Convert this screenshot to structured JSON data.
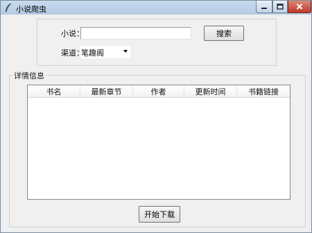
{
  "window": {
    "title": "小说爬虫",
    "icon": "feather-icon"
  },
  "search": {
    "novel_label": "小说：",
    "novel_value": "",
    "search_button": "搜索",
    "channel_label": "渠道：",
    "channel_selected": "笔趣阁"
  },
  "details": {
    "group_label": "详情信息",
    "columns": [
      "书名",
      "最新章节",
      "作者",
      "更新时间",
      "书籍链接"
    ],
    "rows": []
  },
  "actions": {
    "start_download": "开始下载"
  },
  "colors": {
    "titlebar": "#b3cbe4",
    "close_button": "#c0392b",
    "client_bg": "#f0f0f0"
  }
}
